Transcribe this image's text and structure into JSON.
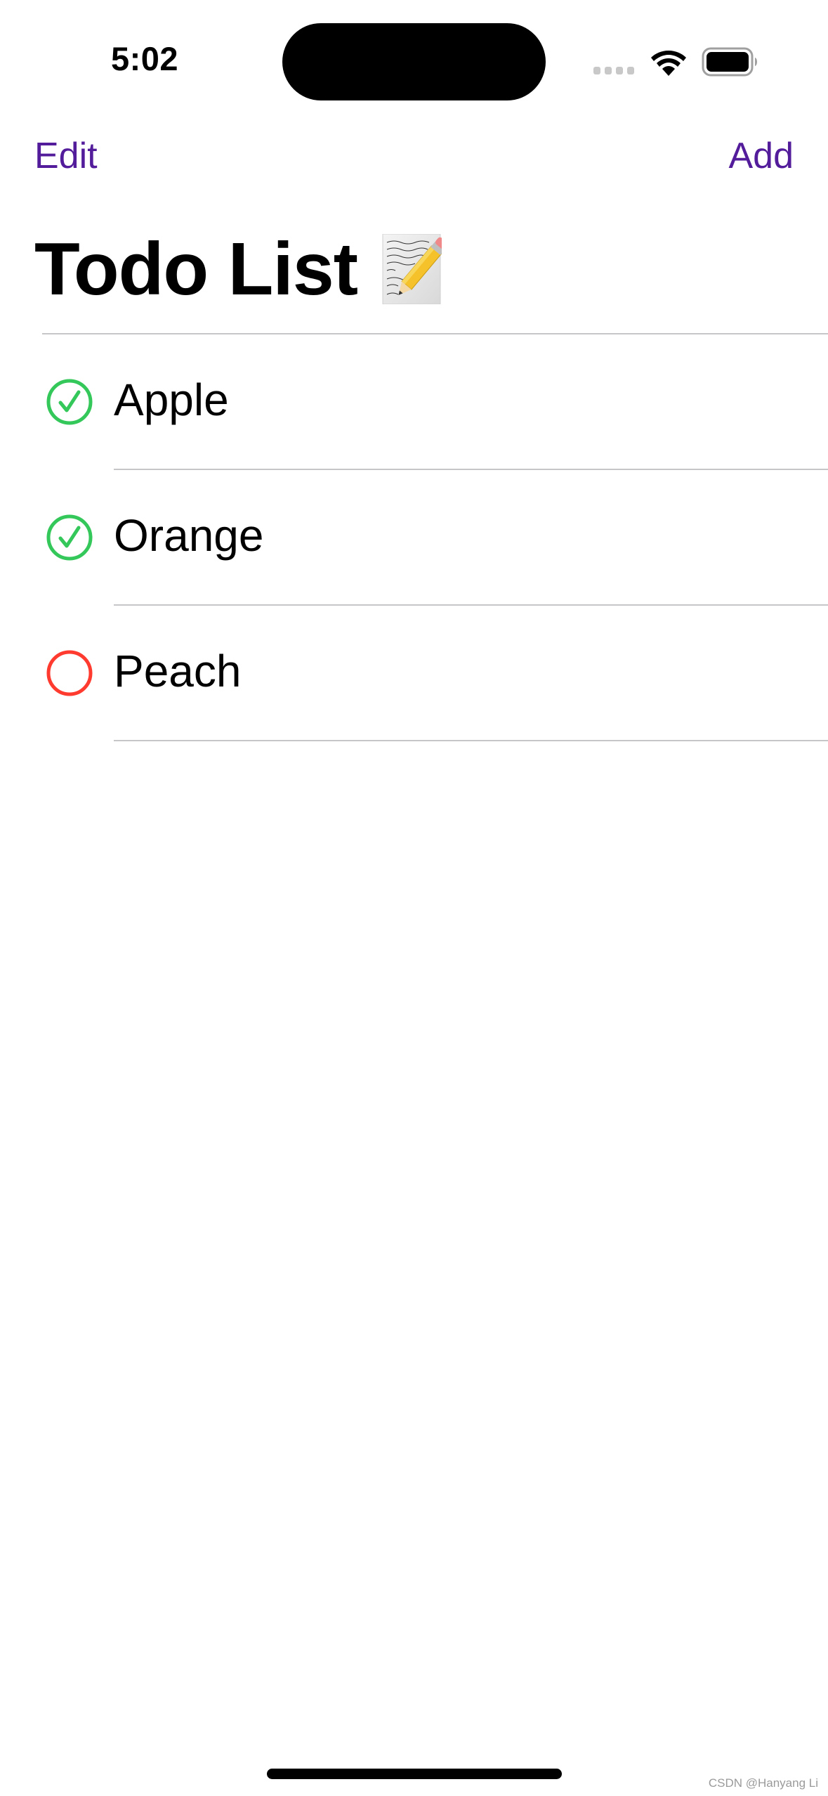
{
  "status_bar": {
    "time": "5:02",
    "signal_icon": "cellular-signal-icon",
    "wifi_icon": "wifi-icon",
    "battery_icon": "battery-icon"
  },
  "nav": {
    "edit_label": "Edit",
    "add_label": "Add",
    "accent_color": "#521C9B"
  },
  "title": {
    "text": "Todo List",
    "emoji": "📝",
    "emoji_icon": "memo-icon"
  },
  "todos": [
    {
      "label": "Apple",
      "completed": true,
      "icon": "checkmark-circle-icon",
      "color": "#34C759"
    },
    {
      "label": "Orange",
      "completed": true,
      "icon": "checkmark-circle-icon",
      "color": "#34C759"
    },
    {
      "label": "Peach",
      "completed": false,
      "icon": "empty-circle-icon",
      "color": "#FF3B30"
    }
  ],
  "watermark": "CSDN @Hanyang Li"
}
